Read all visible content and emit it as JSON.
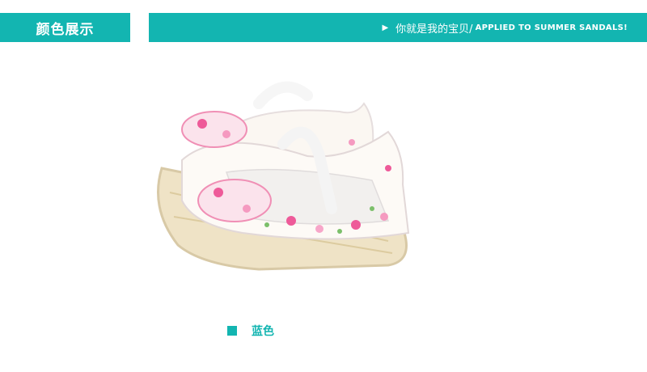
{
  "header": {
    "section_tag": "颜色展示",
    "banner_arrow": "▶",
    "banner_text_cn": "你就是我的宝贝/",
    "banner_text_en": "APPLIED TO SUMMER SANDALS!"
  },
  "product": {
    "image_icon": "baby-sandals-image",
    "color_label": "蓝色"
  },
  "colors": {
    "accent": "#13b5b1",
    "background": "#ffffff"
  }
}
